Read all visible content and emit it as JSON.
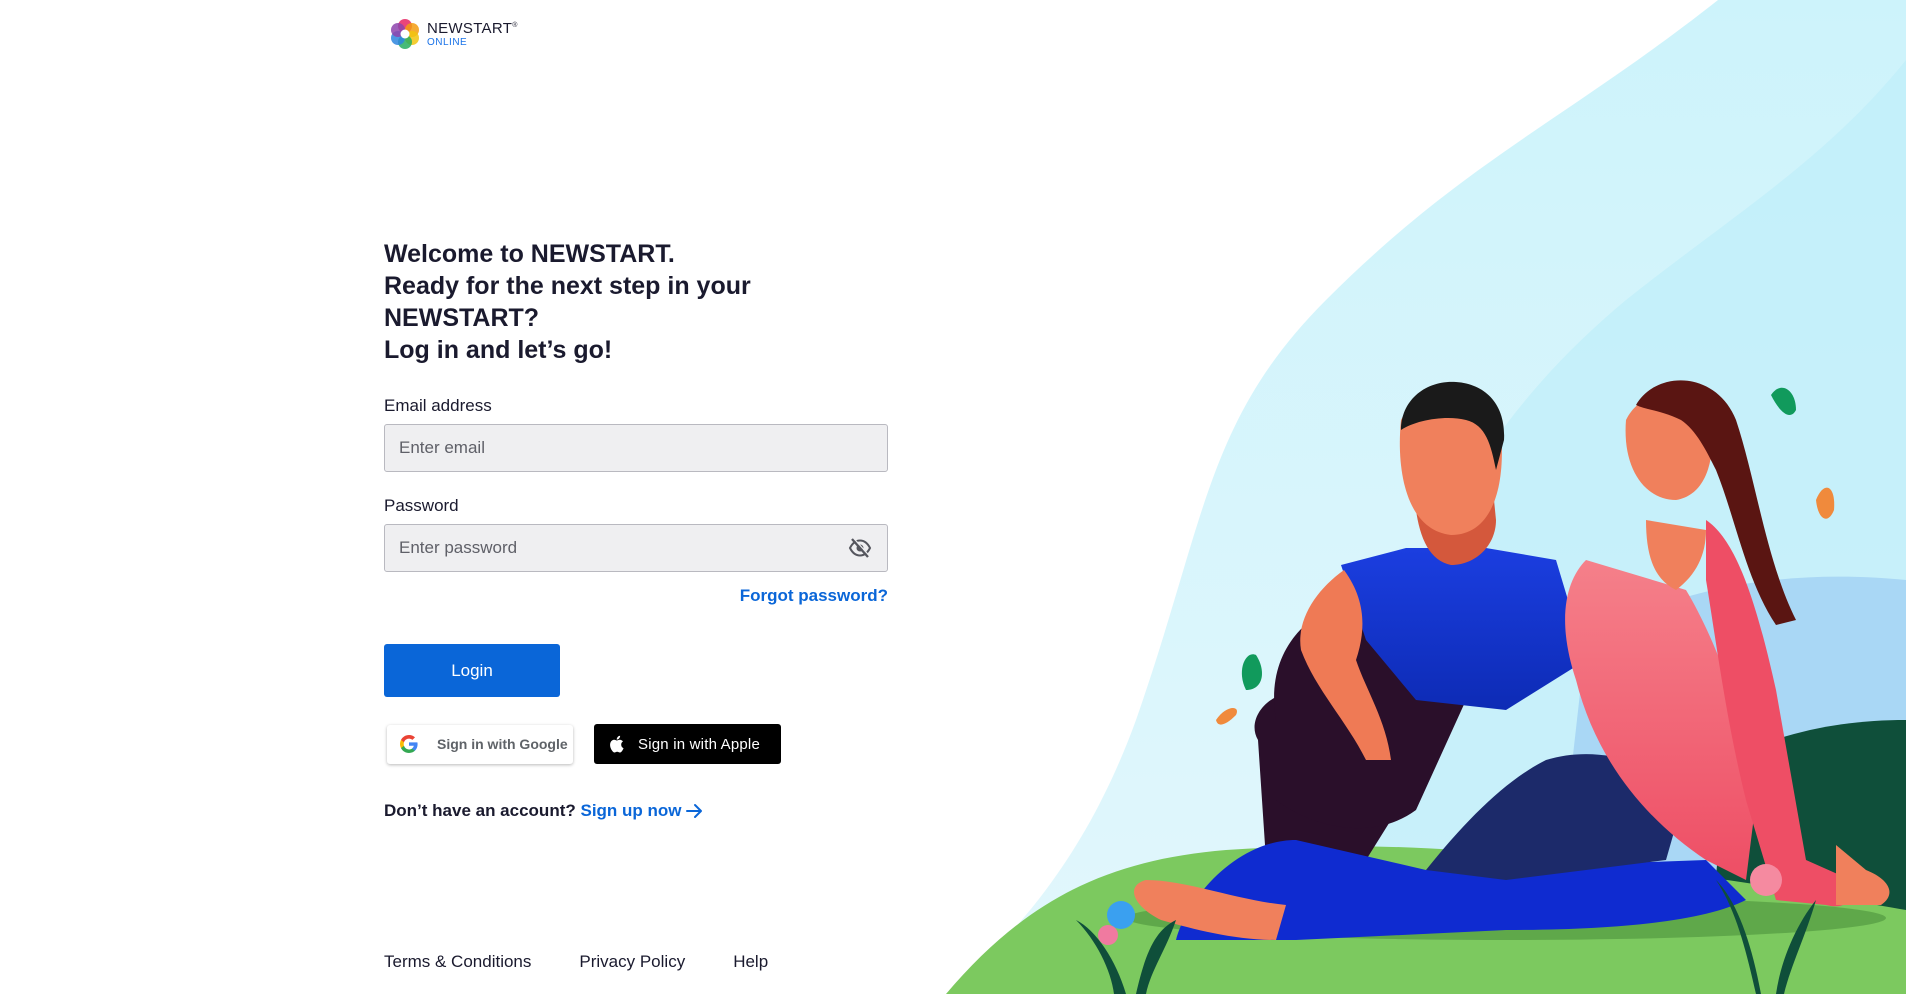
{
  "brand": {
    "name": "NEWSTART",
    "trademark": "®",
    "sub": "ONLINE"
  },
  "headline": {
    "line1": "Welcome to NEWSTART.",
    "line2": "Ready for the next step in your NEWSTART?",
    "line3": "Log in and let’s go!"
  },
  "form": {
    "email_label": "Email address",
    "email_placeholder": "Enter email",
    "email_value": "",
    "password_label": "Password",
    "password_placeholder": "Enter password",
    "password_value": "",
    "forgot_label": "Forgot password?",
    "login_label": "Login"
  },
  "social": {
    "google_label": "Sign in with Google",
    "apple_label": "Sign in with Apple"
  },
  "signup": {
    "question": "Don’t have an account?",
    "link_label": "Sign up now"
  },
  "footer": {
    "terms": "Terms & Conditions",
    "privacy": "Privacy Policy",
    "help": "Help"
  },
  "colors": {
    "accent": "#0a66d8",
    "apple_button": "#000000",
    "input_bg": "#efeff1"
  },
  "icons": [
    "newstart-logo-icon",
    "eye-off-icon",
    "google-icon",
    "apple-icon",
    "arrow-right-icon"
  ]
}
